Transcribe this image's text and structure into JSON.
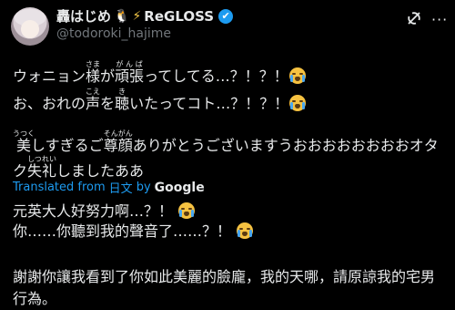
{
  "author": {
    "display_name": "轟はじめ",
    "group_name": "ReGLOSS",
    "handle": "@todoroki_hajime"
  },
  "tweet": {
    "jp_line1": {
      "a": "ウォニョン",
      "b": "様",
      "b_rt": "さま",
      "c": "が",
      "d": "頑張",
      "d_rt": "がんば",
      "e": "ってしてる…？！？！"
    },
    "jp_line2": {
      "a": "お、おれの",
      "b": "声",
      "b_rt": "こえ",
      "c": "を",
      "d": "聴",
      "d_rt": "き",
      "e": "いたってコト…？！？！"
    },
    "jp_line3": {
      "a": "美",
      "a_rt": "うつく",
      "b": "しすぎるご",
      "c": "尊顔",
      "c_rt": "そんがん",
      "d": "ありがとうございますうおおおおおおおおオタ"
    },
    "jp_line4": {
      "a": "ク",
      "b": "失礼",
      "b_rt": "しつれい",
      "c": "しましたああ"
    },
    "translated_prefix": "Translated from",
    "translated_lang": "日文",
    "translated_by": "by",
    "translated_service": "Google",
    "zh_line1": "元英大人好努力啊…？！",
    "zh_line2": "你……你聽到我的聲音了……？！",
    "zh_line3": "謝謝你讓我看到了你如此美麗的臉龐，我的天哪，請原諒我的宅男",
    "zh_line4": "行為。"
  },
  "colors": {
    "link": "#1d9bf0",
    "text": "#e7e9ea",
    "muted": "#71767b",
    "background": "#000000"
  }
}
